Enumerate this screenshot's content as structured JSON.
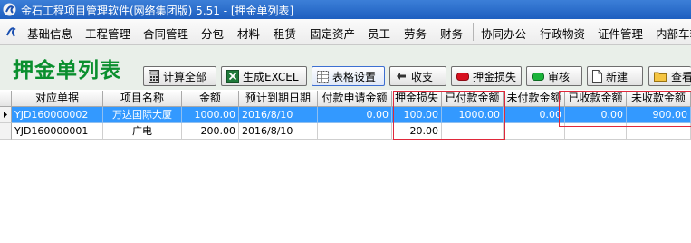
{
  "window": {
    "title": "金石工程项目管理软件(网络集团版) 5.51 - [押金单列表]"
  },
  "menu": {
    "items": [
      "基础信息",
      "工程管理",
      "合同管理",
      "分包",
      "材料",
      "租赁",
      "固定资产",
      "员工",
      "劳务",
      "财务",
      "协同办公",
      "行政物资",
      "证件管理",
      "内部车辆"
    ]
  },
  "page": {
    "title": "押金单列表"
  },
  "toolbar": {
    "calc_all": "计算全部",
    "gen_excel": "生成EXCEL",
    "table_settings": "表格设置",
    "income_expense": "收支",
    "deposit_loss": "押金损失",
    "review": "审核",
    "new": "新建",
    "view": "查看"
  },
  "grid": {
    "columns": [
      "对应单据",
      "项目名称",
      "金额",
      "预计到期日期",
      "付款申请金额",
      "押金损失",
      "已付款金额",
      "未付款金额",
      "已收款金额",
      "未收款金额"
    ],
    "rows": [
      {
        "doc": "YJD160000002",
        "project": "万达国际大厦",
        "amount": "1000.00",
        "due": "2016/8/10",
        "pay_req": "0.00",
        "loss": "100.00",
        "paid": "1000.00",
        "unpaid": "0.00",
        "received": "0.00",
        "unreceived": "900.00",
        "selected": true
      },
      {
        "doc": "YJD160000001",
        "project": "广电",
        "amount": "200.00",
        "due": "2016/8/10",
        "pay_req": "",
        "loss": "20.00",
        "paid": "",
        "unpaid": "",
        "received": "",
        "unreceived": "",
        "selected": false
      }
    ]
  },
  "colors": {
    "title_green": "#0a8f2e",
    "selection": "#3399ff",
    "annotation_red": "#e0283a",
    "titlebar": "#1e5fbf"
  },
  "icons": {
    "app_logo": "app-logo-icon",
    "calc": "calculator-icon",
    "excel": "excel-icon",
    "table_settings": "table-settings-icon",
    "income_expense": "income-expense-icon",
    "deposit_loss": "red-pill-icon",
    "review": "green-pill-icon",
    "new": "new-document-icon",
    "view": "folder-icon"
  }
}
